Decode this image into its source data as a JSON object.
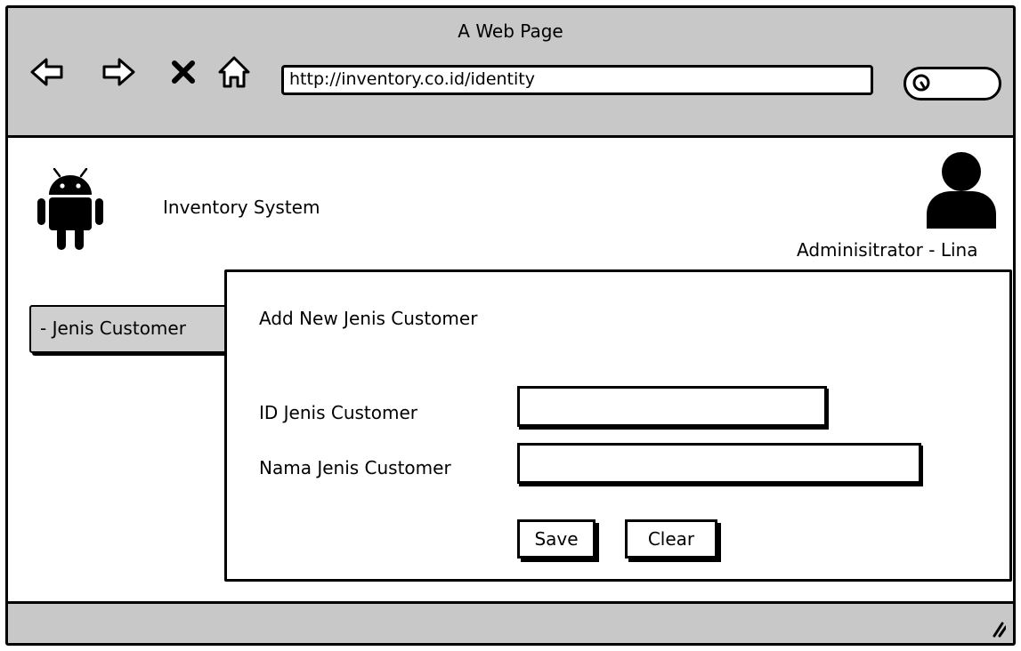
{
  "browser": {
    "title": "A Web Page",
    "url": "http://inventory.co.id/identity",
    "nav_icons": [
      "back-arrow-icon",
      "forward-arrow-icon",
      "close-x-icon",
      "home-icon"
    ],
    "search_placeholder": ""
  },
  "header": {
    "app_name": "Inventory System",
    "logo_icon": "android-icon",
    "user_icon": "user-icon",
    "user_name": "Adminisitrator - Lina"
  },
  "sidebar": {
    "items": [
      {
        "label": "- Jenis Customer"
      }
    ]
  },
  "form": {
    "title": "Add New Jenis Customer",
    "fields": [
      {
        "label": "ID Jenis Customer",
        "value": ""
      },
      {
        "label": "Nama Jenis Customer",
        "value": ""
      }
    ],
    "save_label": "Save",
    "clear_label": "Clear"
  },
  "colors": {
    "chrome_gray": "#c8c8c8",
    "sidebar_gray": "#cfcfcf",
    "ink": "#000000"
  }
}
